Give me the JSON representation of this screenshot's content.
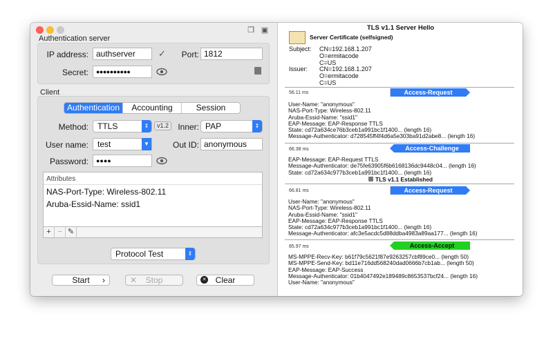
{
  "auth_server": {
    "section_label": "Authentication server",
    "ip_label": "IP address:",
    "ip_value": "authserver",
    "port_label": "Port:",
    "port_value": "1812",
    "secret_label": "Secret:",
    "secret_value": "●●●●●●●●●●"
  },
  "client": {
    "section_label": "Client",
    "tabs": [
      "Authentication",
      "Accounting",
      "Session"
    ],
    "method_label": "Method:",
    "method_value": "TTLS",
    "version_badge": "v1.2",
    "inner_label": "Inner:",
    "inner_value": "PAP",
    "username_label": "User name:",
    "username_value": "test",
    "outid_label": "Out ID:",
    "outid_value": "anonymous",
    "password_label": "Password:",
    "password_value": "●●●●",
    "attributes_label": "Attributes",
    "attributes": [
      "NAS-Port-Type: Wireless-802.11",
      "Aruba-Essid-Name: ssid1"
    ],
    "attr_tools": [
      "+",
      "−",
      "✎"
    ]
  },
  "actions": {
    "protocol_test": "Protocol Test",
    "start": "Start",
    "stop": "Stop",
    "clear": "Clear"
  },
  "log": {
    "title": "TLS v1.1 Server Hello",
    "cert_label": "Server Certificate (selfsigned)",
    "subject_label": "Subject:",
    "subject_lines": [
      "CN=192.168.1.207",
      "O=ermitacode",
      "C=US"
    ],
    "issuer_label": "Issuer:",
    "issuer_lines": [
      "CN=192.168.1.207",
      "O=ermitacode",
      "C=US"
    ],
    "packets": [
      {
        "time": "56.11 ms",
        "type": "Access-Request",
        "lines": [
          "User-Name: \"anonymous\"",
          "NAS-Port-Type: Wireless-802.11",
          "Aruba-Essid-Name: \"ssid1\"",
          "EAP-Message: EAP-Response TTLS",
          "State: cd72a634ce76b3ceb1a991bc1f1400... (length 16)",
          "Message-Authenticator: d728545ff4f4d6a5e303ba91d2abe8... (length 16)"
        ]
      },
      {
        "time": "66.38 ms",
        "type": "Access-Challenge",
        "lines": [
          "EAP-Message: EAP-Request TTLS",
          "Message-Authenticator: de75fe63905f6b6168136dc9448c04... (length 16)",
          "State: cd72a634c977b3ceb1a991bc1f1400... (length 16)"
        ],
        "note": "TLS v1.1 Established"
      },
      {
        "time": "66.81 ms",
        "type": "Access-Request",
        "lines": [
          "User-Name: \"anonymous\"",
          "NAS-Port-Type: Wireless-802.11",
          "Aruba-Essid-Name: \"ssid1\"",
          "EAP-Message: EAP-Response TTLS",
          "State: cd72a634c977b3ceb1a991bc1f1400... (length 16)",
          "Message-Authenticator: afc3e5acdc5d88ddba4983a89aa177... (length 16)"
        ]
      },
      {
        "time": "85.97 ms",
        "type": "Access-Accept",
        "lines": [
          "MS-MPPE-Recv-Key: b61f79c5621f87e9263257cbf89ce0... (length 50)",
          "MS-MPPE-Send-Key: bd11e716dd568240dad0666b7cb1ab... (length 50)",
          "EAP-Message: EAP-Success",
          "Message-Authenticator: 01b4047492e189489c8653537bcf24... (length 16)",
          "User-Name: \"anonymous\""
        ]
      }
    ]
  },
  "colors": {
    "accent": "#2f7cf6",
    "accept": "#21d121"
  },
  "icons": [
    "close-light",
    "minimize-light",
    "zoom-light",
    "copy-icon",
    "save-icon",
    "checkmark-icon",
    "eye-icon",
    "clipboard-icon",
    "certificate-icon",
    "lock-icon",
    "chevron-right-icon",
    "x-icon",
    "x-circle-icon"
  ]
}
